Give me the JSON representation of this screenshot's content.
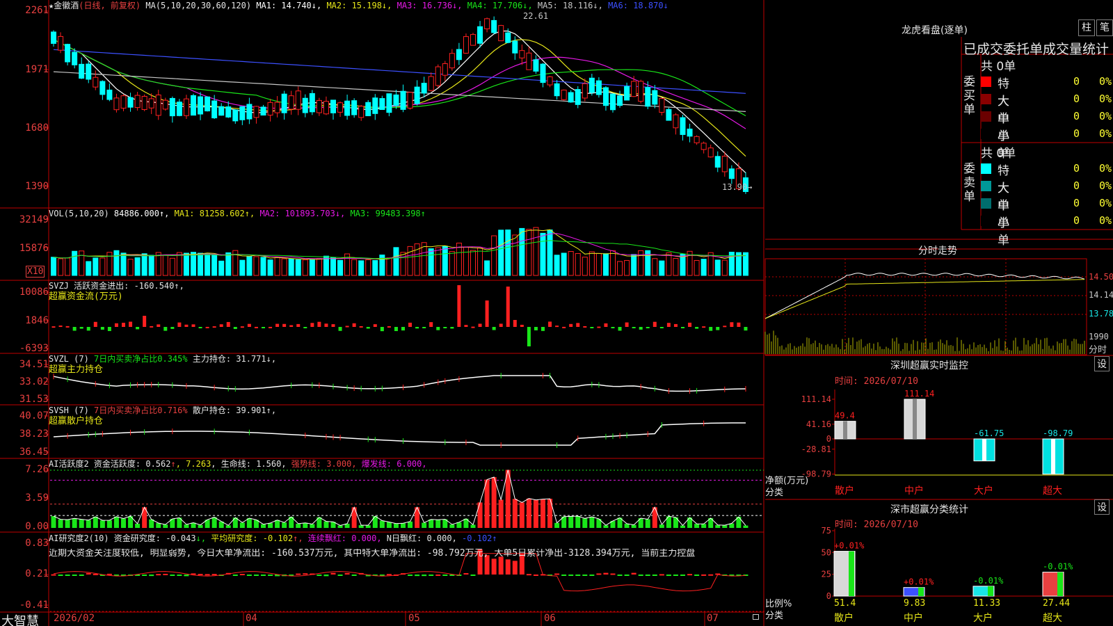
{
  "app": {
    "brand": "大智慧"
  },
  "price_panel": {
    "legend": [
      {
        "text": "★金徽酒",
        "color": "#e6e6e6"
      },
      {
        "text": "(日线, 前复权)",
        "color": "#e84040"
      },
      {
        "text": " MA(5,10,20,30,60,120) ",
        "color": "#e6e6e6"
      },
      {
        "text": "MA1: 14.740↓,",
        "color": "#ffffff"
      },
      {
        "text": " MA2: 15.198↓,",
        "color": "#e6e619"
      },
      {
        "text": " MA3: 16.736↓,",
        "color": "#e619e6"
      },
      {
        "text": " MA4: 17.706↓,",
        "color": "#19e619"
      },
      {
        "text": " MA5: 18.116↓,",
        "color": "#c8c8c8"
      },
      {
        "text": " MA6: 18.870↓",
        "color": "#3c50ff"
      }
    ],
    "y_ticks": [
      "2261",
      "1971",
      "1680",
      "1390"
    ],
    "high_label": "22.61",
    "low_label": "13.90→"
  },
  "vol_panel": {
    "legend": [
      {
        "text": "VOL(5,10,20) ",
        "color": "#e6e6e6"
      },
      {
        "text": "84886.000↑,",
        "color": "#ffffff"
      },
      {
        "text": " MA1: 81258.602↑,",
        "color": "#e6e619"
      },
      {
        "text": " MA2: 101893.703↓,",
        "color": "#e619e6"
      },
      {
        "text": " MA3: 99483.398↑",
        "color": "#19e619"
      }
    ],
    "y_ticks": [
      "32149",
      "15876"
    ],
    "multiplier": "X10"
  },
  "svzj_panel": {
    "legend": [
      {
        "text": "SVZJ  活跃资金进出: -160.540↑,",
        "color": "#e6e6e6"
      }
    ],
    "subtitle": "超赢资金流(万元)",
    "y_ticks": [
      "10086",
      "1846",
      "-6393"
    ]
  },
  "svzl_panel": {
    "legend": [
      {
        "text": "SVZL (7) ",
        "color": "#e6e6e6"
      },
      {
        "text": "7日内买卖净占比0.345%",
        "color": "#19e619"
      },
      {
        "text": " 主力持仓: 31.771↓,",
        "color": "#e6e6e6"
      }
    ],
    "subtitle": "超赢主力持仓",
    "y_ticks": [
      "34.51",
      "33.02",
      "31.53"
    ]
  },
  "svsh_panel": {
    "legend": [
      {
        "text": "SVSH (7) ",
        "color": "#e6e6e6"
      },
      {
        "text": "7日内买卖净占比0.716%",
        "color": "#e84040"
      },
      {
        "text": " 散户持仓: 39.901↑,",
        "color": "#e6e6e6"
      }
    ],
    "subtitle": "超赢散户持仓",
    "y_ticks": [
      "40.07",
      "38.23",
      "36.45"
    ]
  },
  "ai_active_panel": {
    "legend": [
      {
        "text": "AI活跃度2 资金活跃度: 0.562",
        "color": "#e6e6e6"
      },
      {
        "text": "↑",
        "color": "#e84040"
      },
      {
        "text": ", 7.263",
        "color": "#e6e619"
      },
      {
        "text": ", 生命线: 1.560,",
        "color": "#e6e6e6"
      },
      {
        "text": " 强势线: 3.000,",
        "color": "#e84040"
      },
      {
        "text": " 爆发线: 6.000,",
        "color": "#e619e6"
      }
    ],
    "y_ticks": [
      "7.26",
      "3.59",
      "0.00"
    ]
  },
  "ai_research_panel": {
    "legend": [
      {
        "text": "AI研究度2(10) 资金研究度: -0.043",
        "color": "#e6e6e6"
      },
      {
        "text": "↓,",
        "color": "#19e619"
      },
      {
        "text": " 平均研究度: -0.102",
        "color": "#e6e619"
      },
      {
        "text": "↑,",
        "color": "#e84040"
      },
      {
        "text": " 连续飘红: 0.000,",
        "color": "#e619e6"
      },
      {
        "text": " N日飘红: 0.000,",
        "color": "#e6e6e6"
      },
      {
        "text": " -0.102↑",
        "color": "#3c50ff"
      }
    ],
    "comment": "近期大资金关注度较低, 明显弱势, 今日大单净流出: -160.537万元, 其中特大单净流出: -98.792万元, 大单5日累计净出-3128.394万元, 当前主力控盘",
    "y_ticks": [
      "0.83",
      "0.21",
      "-0.41"
    ]
  },
  "x_axis": {
    "labels": [
      "2026/02",
      "04",
      "05",
      "06",
      "07"
    ]
  },
  "dragon_tiger": {
    "title": "龙虎看盘(逐单)",
    "mode_buttons": [
      "柱",
      "笔"
    ],
    "header": "已成交委托单成交量统计",
    "buy": {
      "side_label": "委买单",
      "total": "共 0单",
      "rows": [
        {
          "label": "特大",
          "count": "0",
          "pct": "0%",
          "color": "#ff0000"
        },
        {
          "label": "大单",
          "count": "0",
          "pct": "0%",
          "color": "#8b0000"
        },
        {
          "label": "中单",
          "count": "0",
          "pct": "0%",
          "color": "#6b0000"
        },
        {
          "label": "小单",
          "count": "0",
          "pct": "0%",
          "color": "#000000"
        }
      ]
    },
    "sell": {
      "side_label": "委卖单",
      "total": "共 0单",
      "rows": [
        {
          "label": "特大",
          "count": "0",
          "pct": "0%",
          "color": "#00ffff"
        },
        {
          "label": "大单",
          "count": "0",
          "pct": "0%",
          "color": "#009898"
        },
        {
          "label": "中单",
          "count": "0",
          "pct": "0%",
          "color": "#006e6e"
        },
        {
          "label": "小单",
          "count": "0",
          "pct": "0%",
          "color": "#000000"
        }
      ]
    }
  },
  "intraday": {
    "title": "分时走势",
    "y_ticks": [
      "14.50",
      "14.14",
      "13.78"
    ],
    "vol_tick": "1990",
    "vol_label": "分时"
  },
  "monitor": {
    "title": "深圳超赢实时监控",
    "settings_label": "设",
    "time": "时间: 2026/07/10",
    "y_ticks": [
      "111.14",
      "41.16",
      "0",
      "-28.81",
      "-98.79"
    ],
    "axis_label": "净额(万元)",
    "category_label": "分类",
    "chart_data": {
      "type": "bar",
      "categories": [
        "散户",
        "中户",
        "大户",
        "超大"
      ],
      "values": [
        49.4,
        111.14,
        -61.75,
        -98.79
      ],
      "ylim": [
        -98.79,
        111.14
      ]
    }
  },
  "classify": {
    "title": "深市超赢分类统计",
    "settings_label": "设",
    "time": "时间: 2026/07/10",
    "y_ticks": [
      "75",
      "50",
      "25",
      "0"
    ],
    "axis_label": "比例%",
    "category_label": "分类",
    "chart_data": {
      "type": "bar",
      "categories": [
        "散户",
        "中户",
        "大户",
        "超大"
      ],
      "values": [
        51.4,
        9.83,
        11.33,
        27.44
      ],
      "changes": [
        "+0.01%",
        "+0.01%",
        "-0.01%",
        "-0.01%"
      ],
      "ylim": [
        0,
        75
      ]
    }
  },
  "colors": {
    "up": "#ff2020",
    "down": "#00ffff",
    "frame": "#c00000"
  }
}
